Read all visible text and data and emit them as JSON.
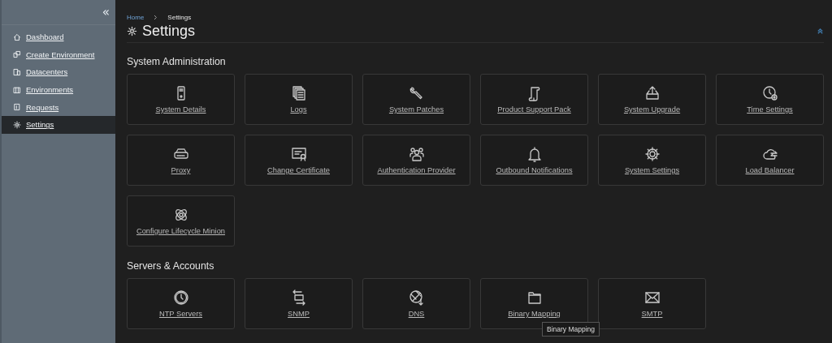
{
  "sidebar": {
    "collapse_label": "«",
    "items": [
      {
        "label": "Dashboard",
        "selected": false
      },
      {
        "label": "Create Environment",
        "selected": false
      },
      {
        "label": "Datacenters",
        "selected": false
      },
      {
        "label": "Environments",
        "selected": false
      },
      {
        "label": "Requests",
        "selected": false
      },
      {
        "label": "Settings",
        "selected": true
      }
    ]
  },
  "breadcrumb": [
    "Home",
    "Settings"
  ],
  "page_title": "Settings",
  "sections": [
    {
      "title": "System Administration",
      "tiles": [
        {
          "label": "System Details"
        },
        {
          "label": "Logs"
        },
        {
          "label": "System Patches"
        },
        {
          "label": "Product Support Pack"
        },
        {
          "label": "System Upgrade"
        },
        {
          "label": "Time Settings"
        },
        {
          "label": "Proxy"
        },
        {
          "label": "Change Certificate"
        },
        {
          "label": "Authentication Provider"
        },
        {
          "label": "Outbound Notifications"
        },
        {
          "label": "System Settings"
        },
        {
          "label": "Load Balancer"
        },
        {
          "label": "Configure Lifecycle Minion"
        }
      ]
    },
    {
      "title": "Servers & Accounts",
      "tiles": [
        {
          "label": "NTP Servers"
        },
        {
          "label": "SNMP"
        },
        {
          "label": "DNS"
        },
        {
          "label": "Binary Mapping",
          "tooltip": "Binary Mapping"
        },
        {
          "label": "SMTP"
        }
      ]
    }
  ]
}
